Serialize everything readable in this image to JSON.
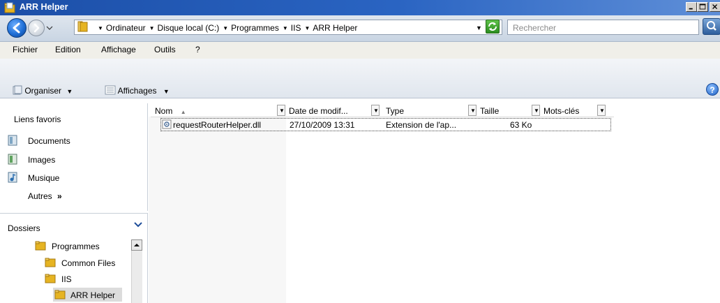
{
  "window": {
    "title": "ARR Helper"
  },
  "address": {
    "crumbs": [
      "Ordinateur",
      "Disque local (C:)",
      "Programmes",
      "IIS",
      "ARR Helper"
    ],
    "search_placeholder": "Rechercher"
  },
  "menu": {
    "items": [
      "Fichier",
      "Edition",
      "Affichage",
      "Outils",
      "?"
    ]
  },
  "toolbar": {
    "organize_label": "Organiser",
    "views_label": "Affichages"
  },
  "favorites": {
    "heading": "Liens favoris",
    "items": [
      "Documents",
      "Images",
      "Musique"
    ],
    "more_label": "Autres",
    "more_glyph": "»"
  },
  "folders": {
    "heading": "Dossiers",
    "items": [
      "Programmes",
      "Common Files",
      "IIS",
      "ARR Helper"
    ],
    "selected": "ARR Helper"
  },
  "file_list": {
    "columns": [
      "Nom",
      "Date de modif...",
      "Type",
      "Taille",
      "Mots-clés"
    ],
    "rows": [
      {
        "name": "requestRouterHelper.dll",
        "date": "27/10/2009 13:31",
        "type": "Extension de l'ap...",
        "size": "63 Ko",
        "keywords": ""
      }
    ]
  },
  "colors": {
    "titlebar": "#1c4fa8",
    "folder": "#e6b422",
    "selection": "#dcdcdc"
  },
  "icons": {
    "back": "back-arrow-icon",
    "forward": "forward-arrow-icon",
    "refresh": "refresh-icon",
    "search": "magnifier-icon",
    "help": "help-icon",
    "folder": "folder-icon",
    "dll": "dll-file-icon"
  }
}
